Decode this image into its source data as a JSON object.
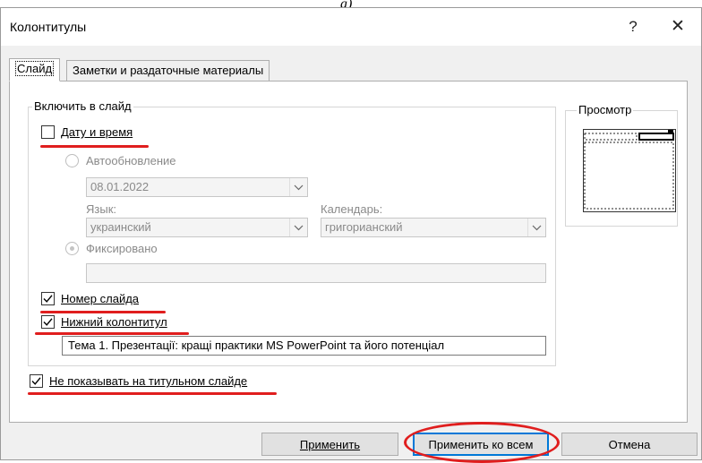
{
  "caption": "а)",
  "window": {
    "title": "Колонтитулы",
    "help": "?",
    "close": "✕"
  },
  "tabs": [
    {
      "label": "Слайд"
    },
    {
      "label": "Заметки и раздаточные материалы"
    }
  ],
  "include_group": {
    "legend": "Включить в слайд",
    "date_time": {
      "label": "Дату и время",
      "checked": false
    },
    "auto_update": {
      "label": "Автообновление",
      "selected": false
    },
    "date_value": "08.01.2022",
    "language_label": "Язык:",
    "language_value": "украинский",
    "calendar_label": "Календарь:",
    "calendar_value": "григорианский",
    "fixed": {
      "label": "Фиксировано",
      "selected": true
    },
    "slide_number": {
      "label": "Номер слайда",
      "checked": true
    },
    "footer": {
      "label": "Нижний колонтитул",
      "checked": true
    },
    "footer_text": "Тема 1. Презентації: кращі практики MS PowerPoint та його потенціал"
  },
  "dont_show_title": {
    "label": "Не показывать на титульном слайде",
    "checked": true
  },
  "preview": {
    "legend": "Просмотр"
  },
  "buttons": {
    "apply": "Применить",
    "apply_all": "Применить ко всем",
    "cancel": "Отмена"
  },
  "colors": {
    "annotation": "#e01e1e",
    "default_button_border": "#0078d7"
  }
}
